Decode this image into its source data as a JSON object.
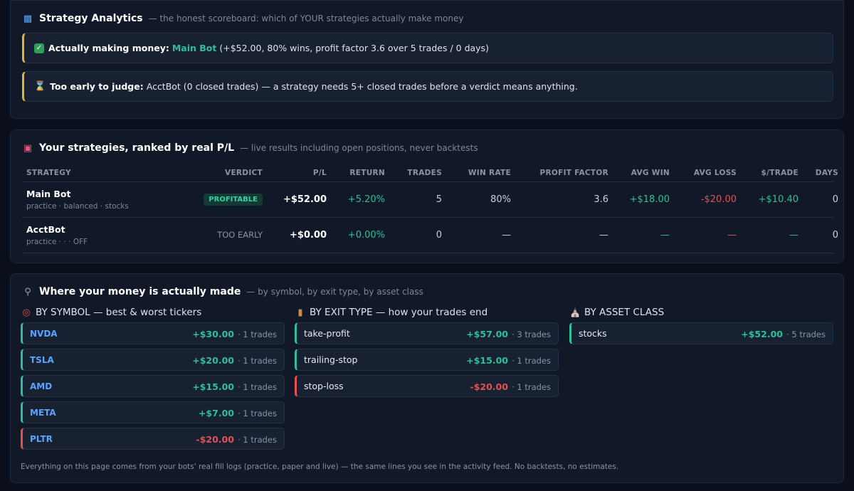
{
  "analytics": {
    "icon": "bar-chart-icon",
    "title": "Strategy Analytics",
    "subtitle": "— the honest scoreboard: which of YOUR strategies actually make money",
    "callouts": [
      {
        "icon": "check-mark-icon",
        "label": "Actually making money:",
        "bot": "Main Bot",
        "text": "(+$52.00, 80% wins, profit factor 3.6 over 5 trades / 0 days)"
      },
      {
        "icon": "hourglass-icon",
        "label": "Too early to judge:",
        "text": "AcctBot (0 closed trades) — a strategy needs 5+ closed trades before a verdict means anything."
      }
    ],
    "accent_color": "#e0b43a"
  },
  "ranking": {
    "icon": "robot-icon",
    "title": "Your strategies, ranked by real P/L",
    "subtitle": "— live results including open positions, never backtests",
    "columns": [
      "STRATEGY",
      "VERDICT",
      "P/L",
      "RETURN",
      "TRADES",
      "WIN RATE",
      "PROFIT FACTOR",
      "AVG WIN",
      "AVG LOSS",
      "$/TRADE",
      "DAYS"
    ],
    "rows": [
      {
        "name": "Main Bot",
        "meta": "practice · balanced · stocks",
        "verdict": "PROFITABLE",
        "pl": "+$52.00",
        "return": "+5.20%",
        "trades": "5",
        "win_rate": "80%",
        "profit_factor": "3.6",
        "avg_win": "+$18.00",
        "avg_loss": "-$20.00",
        "per_trade": "+$10.40",
        "days": "0"
      },
      {
        "name": "AcctBot",
        "meta": "practice · · · OFF",
        "verdict": "TOO EARLY",
        "pl": "+$0.00",
        "return": "+0.00%",
        "trades": "0",
        "win_rate": "—",
        "profit_factor": "—",
        "avg_win": "—",
        "avg_loss": "—",
        "per_trade": "—",
        "days": "0"
      }
    ]
  },
  "breakdown": {
    "icon": "microscope-icon",
    "title": "Where your money is actually made",
    "subtitle": "— by symbol, by exit type, by asset class",
    "by_symbol": {
      "icon": "target-icon",
      "title": "BY SYMBOL — best & worst tickers",
      "items": [
        {
          "label": "NVDA",
          "value": "+$30.00",
          "count": "· 1 trades"
        },
        {
          "label": "TSLA",
          "value": "+$20.00",
          "count": "· 1 trades"
        },
        {
          "label": "AMD",
          "value": "+$15.00",
          "count": "· 1 trades"
        },
        {
          "label": "META",
          "value": "+$7.00",
          "count": "· 1 trades"
        },
        {
          "label": "PLTR",
          "value": "-$20.00",
          "count": "· 1 trades"
        }
      ]
    },
    "by_exit": {
      "icon": "door-icon",
      "title": "BY EXIT TYPE — how your trades end",
      "items": [
        {
          "label": "take-profit",
          "value": "+$57.00",
          "count": "· 3 trades"
        },
        {
          "label": "trailing-stop",
          "value": "+$15.00",
          "count": "· 1 trades"
        },
        {
          "label": "stop-loss",
          "value": "-$20.00",
          "count": "· 1 trades"
        }
      ]
    },
    "by_asset": {
      "icon": "bank-icon",
      "title": "BY ASSET CLASS",
      "items": [
        {
          "label": "stocks",
          "value": "+$52.00",
          "count": "· 5 trades"
        }
      ]
    },
    "footnote": "Everything on this page comes from your bots' real fill logs (practice, paper and live) — the same lines you see in the activity feed. No backtests, no estimates."
  },
  "colors": {
    "positive": "#2fbf9a",
    "negative": "#e25252",
    "symbol_link": "#5aa3ff"
  }
}
